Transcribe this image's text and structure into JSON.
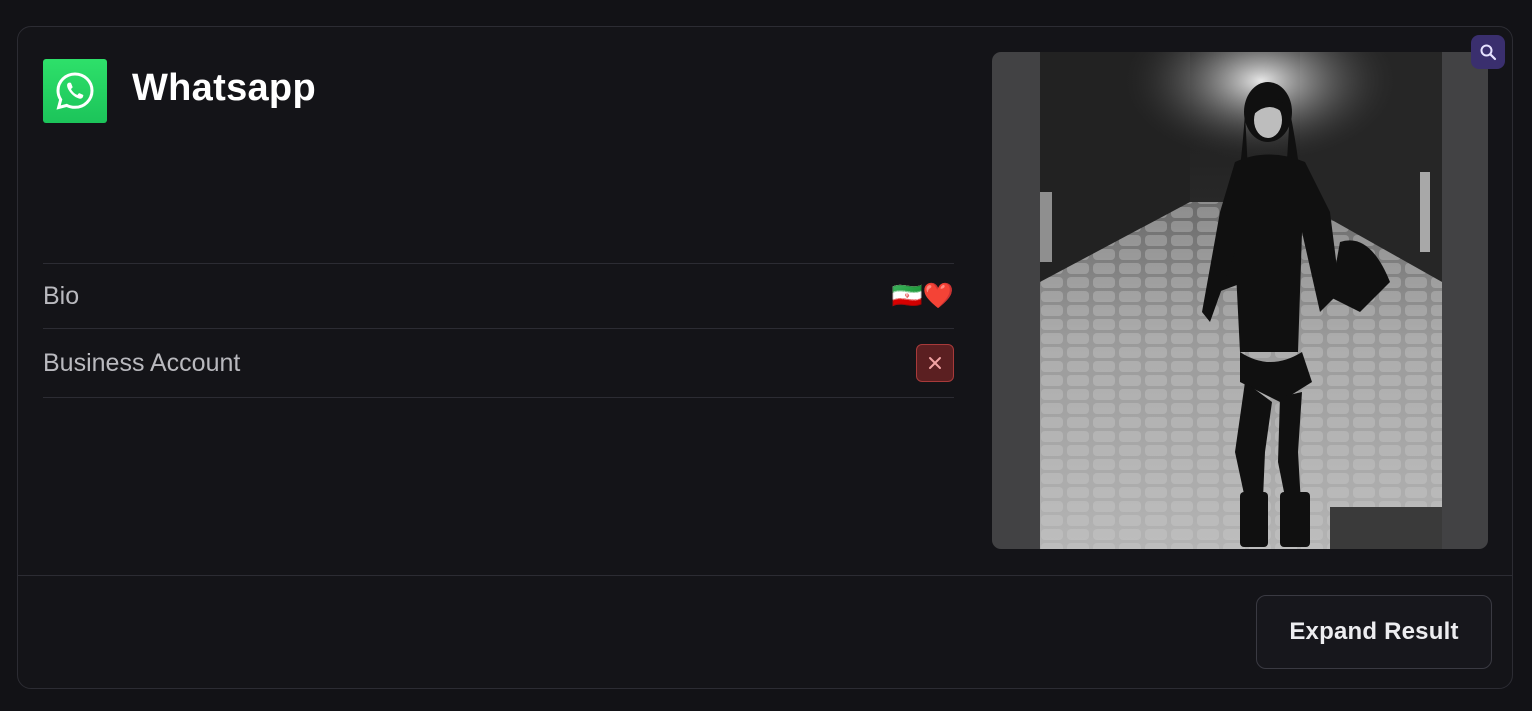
{
  "app": {
    "name": "Whatsapp",
    "logo_icon": "whatsapp-icon",
    "logo_color": "#25D366"
  },
  "fields": [
    {
      "label": "Bio",
      "value": "🇮🇷❤️"
    },
    {
      "label": "Business Account",
      "value_icon": "close-icon",
      "status_color": "#a83a3a"
    }
  ],
  "profile_photo": {
    "zoom_icon": "search-icon",
    "accent_color": "#3a2f6e"
  },
  "actions": {
    "expand_label": "Expand Result"
  }
}
